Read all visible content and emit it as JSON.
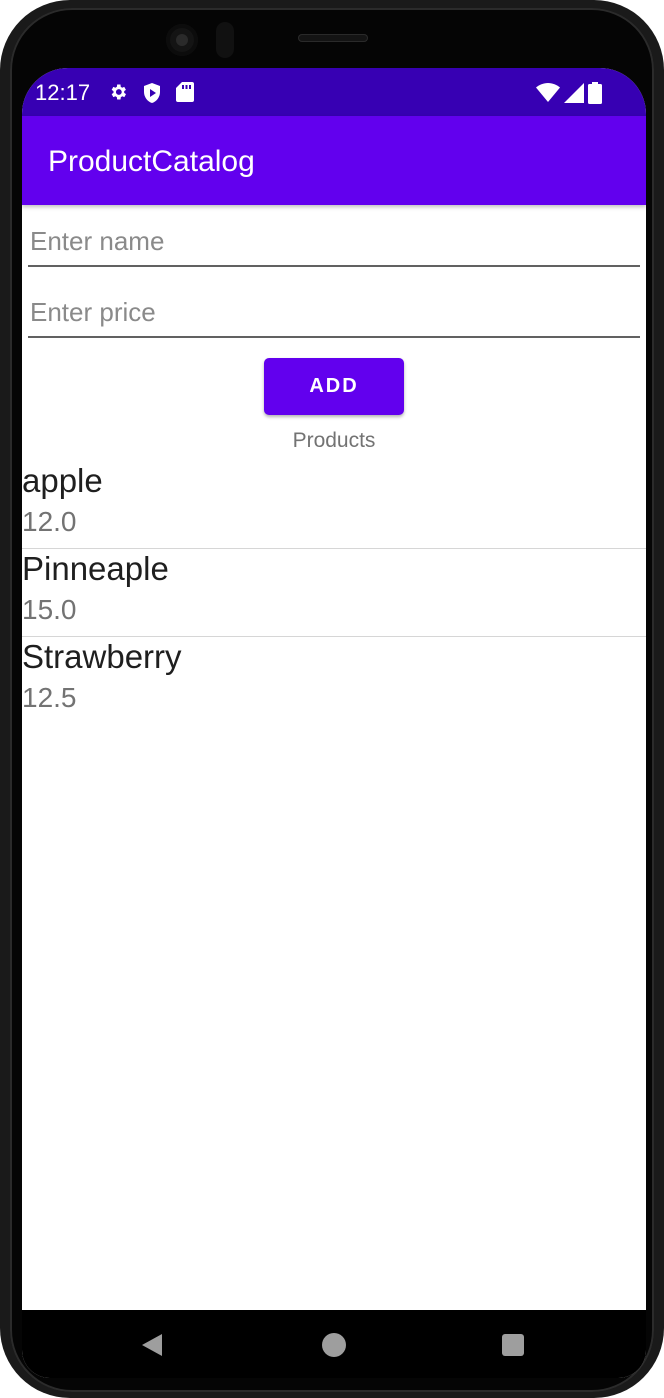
{
  "status_bar": {
    "time": "12:17",
    "left_icons": [
      "settings-icon",
      "shield-play-icon",
      "sd-card-icon"
    ],
    "right_icons": [
      "wifi-icon",
      "signal-icon",
      "battery-icon"
    ],
    "color": "#3700b3"
  },
  "app_bar": {
    "title": "ProductCatalog",
    "color": "#6200ee"
  },
  "form": {
    "name_placeholder": "Enter name",
    "name_value": "",
    "price_placeholder": "Enter price",
    "price_value": "",
    "add_label": "ADD"
  },
  "list": {
    "heading": "Products",
    "items": [
      {
        "name": "apple",
        "price": "12.0"
      },
      {
        "name": "Pinneaple",
        "price": "15.0"
      },
      {
        "name": "Strawberry",
        "price": "12.5"
      }
    ]
  },
  "nav_bar": {
    "buttons": [
      "back-icon",
      "home-icon",
      "recents-icon"
    ]
  }
}
